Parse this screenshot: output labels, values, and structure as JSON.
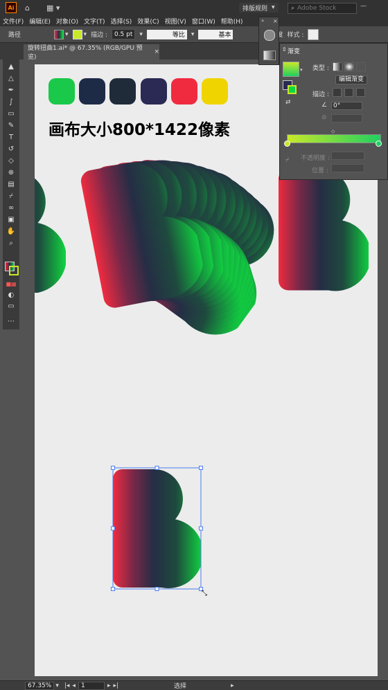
{
  "app": {
    "logo": "Ai",
    "home_icon": "home-icon",
    "arrange_icon": "arrange-documents-icon"
  },
  "workspace": {
    "label": "排版规则",
    "search_placeholder": "Adobe Stock"
  },
  "menu": [
    "文件(F)",
    "编辑(E)",
    "对象(O)",
    "文字(T)",
    "选择(S)",
    "效果(C)",
    "视图(V)",
    "窗口(W)",
    "帮助(H)"
  ],
  "control": {
    "selection_label": "路径",
    "stroke_label": "描边 :",
    "stroke_value": "0.5 pt",
    "stroke_profile": "等比",
    "brush_label": "基本",
    "opacity_label": "不透明度",
    "style_label": "样式 :"
  },
  "document_tab": {
    "title": "旋转扭曲1.ai* @ 67.35% (RGB/GPU 预览)",
    "close": "×"
  },
  "artboard": {
    "heading": "画布大小800*1422像素",
    "palette": [
      "#1ac94a",
      "#1e2b47",
      "#202b3a",
      "#2b2a55",
      "#f02b40",
      "#f0d400"
    ]
  },
  "gradient_panel": {
    "tab": "渐变",
    "type_label": "类型 :",
    "edit_button": "编辑渐变",
    "stroke_label": "描边 :",
    "angle": "0°",
    "opacity_label": "不透明度 :",
    "location_label": "位置 :",
    "start_color": "#c8e82a",
    "end_color": "#20d060"
  },
  "status": {
    "zoom": "67.35%",
    "page": "1",
    "tool": "选择"
  },
  "art_colors": {
    "red": "#f02b40",
    "navy": "#252d45",
    "green": "#10d840"
  }
}
